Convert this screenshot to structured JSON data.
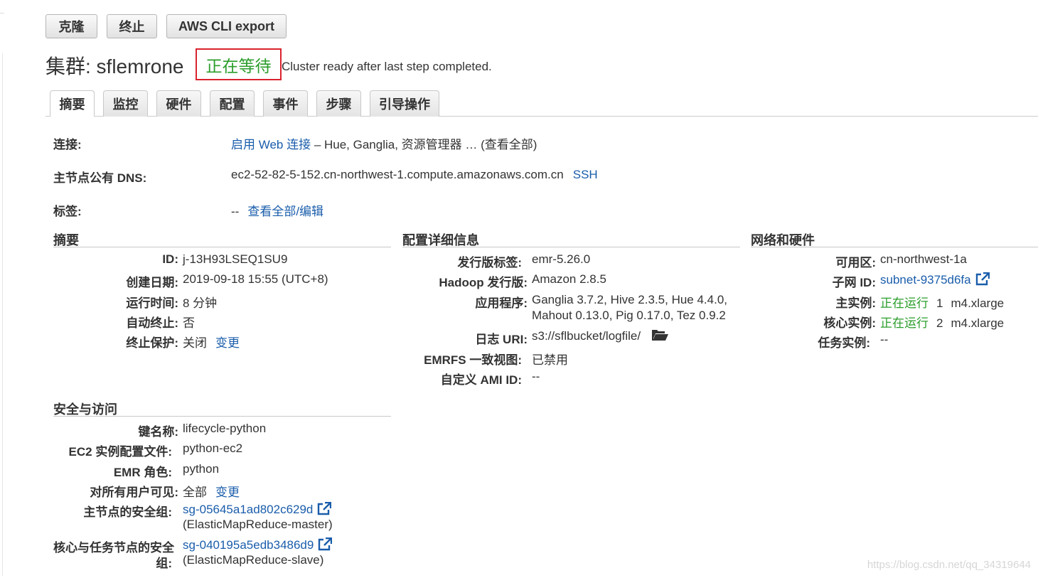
{
  "toolbar": {
    "clone": "克隆",
    "terminate": "终止",
    "aws_cli": "AWS CLI export"
  },
  "header": {
    "title": "集群: sflemrone",
    "status": "正在等待",
    "status_message": "Cluster ready after last step completed."
  },
  "tabs": [
    "摘要",
    "监控",
    "硬件",
    "配置",
    "事件",
    "步骤",
    "引导操作"
  ],
  "top": {
    "connect_label": "连接:",
    "connect_link": "启用 Web 连接",
    "connect_rest": " – Hue, Ganglia, 资源管理器 … (查看全部)",
    "dns_label": "主节点公有 DNS:",
    "dns_value": "ec2-52-82-5-152.cn-northwest-1.compute.amazonaws.com.cn",
    "ssh": "SSH",
    "tags_label": "标签:",
    "tags_value": "--",
    "tags_link": "查看全部/编辑"
  },
  "summary": {
    "heading": "摘要",
    "id_label": "ID:",
    "id_value": "j-13H93LSEQ1SU9",
    "created_label": "创建日期:",
    "created_value": "2019-09-18 15:55 (UTC+8)",
    "elapsed_label": "运行时间:",
    "elapsed_value": "8 分钟",
    "auto_term_label": "自动终止:",
    "auto_term_value": "否",
    "protect_label": "终止保护:",
    "protect_value": "关闭",
    "protect_change": "变更"
  },
  "config": {
    "heading": "配置详细信息",
    "release_label": "发行版标签:",
    "release_value": "emr-5.26.0",
    "hadoop_label": "Hadoop 发行版:",
    "hadoop_value": "Amazon 2.8.5",
    "apps_label": "应用程序:",
    "apps_line1": "Ganglia 3.7.2, Hive 2.3.5, Hue 4.4.0,",
    "apps_line2": "Mahout 0.13.0, Pig 0.17.0, Tez 0.9.2",
    "log_label": "日志 URI:",
    "log_value": "s3://sflbucket/logfile/",
    "emrfs_label": "EMRFS 一致视图:",
    "emrfs_value": "已禁用",
    "ami_label": "自定义 AMI ID:",
    "ami_value": "--"
  },
  "network": {
    "heading": "网络和硬件",
    "az_label": "可用区:",
    "az_value": "cn-northwest-1a",
    "subnet_label": "子网 ID:",
    "subnet_value": "subnet-9375d6fa",
    "master_label": "主实例:",
    "master_status": "正在运行",
    "master_count": "1",
    "master_type": "m4.xlarge",
    "core_label": "核心实例:",
    "core_status": "正在运行",
    "core_count": "2",
    "core_type": "m4.xlarge",
    "task_label": "任务实例:",
    "task_value": "--"
  },
  "security": {
    "heading": "安全与访问",
    "key_label": "键名称:",
    "key_value": "lifecycle-python",
    "profile_label": "EC2 实例配置文件:",
    "profile_value": "python-ec2",
    "role_label": "EMR 角色:",
    "role_value": "python",
    "visible_label": "对所有用户可见:",
    "visible_value": "全部",
    "visible_change": "变更",
    "master_sg_label": "主节点的安全组:",
    "master_sg_value": "sg-05645a1ad802c629d",
    "master_sg_name": "(ElasticMapReduce-master)",
    "slave_sg_label_1": "核心与任务节点的安全",
    "slave_sg_label_2": "组:",
    "slave_sg_value": "sg-040195a5edb3486d9",
    "slave_sg_name": "(ElasticMapReduce-slave)"
  },
  "watermark": "https://blog.csdn.net/qq_34319644",
  "colors": {
    "link": "#1a5dab",
    "running": "#2a9d2a",
    "highlight_border": "#d9232d"
  }
}
